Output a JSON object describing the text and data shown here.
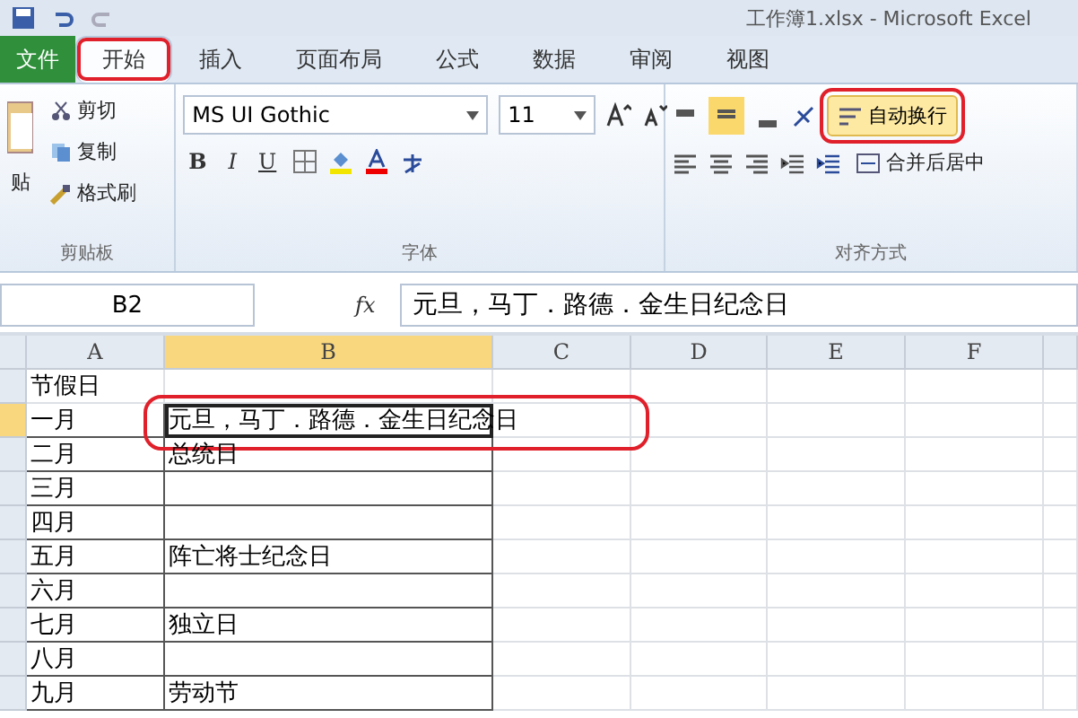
{
  "window": {
    "title": "工作簿1.xlsx - Microsoft Excel"
  },
  "tabs": [
    {
      "label": "文件",
      "kind": "file",
      "selected": false
    },
    {
      "label": "开始",
      "kind": "tab",
      "selected": true
    },
    {
      "label": "插入",
      "kind": "tab",
      "selected": false
    },
    {
      "label": "页面布局",
      "kind": "tab",
      "selected": false
    },
    {
      "label": "公式",
      "kind": "tab",
      "selected": false
    },
    {
      "label": "数据",
      "kind": "tab",
      "selected": false
    },
    {
      "label": "审阅",
      "kind": "tab",
      "selected": false
    },
    {
      "label": "视图",
      "kind": "tab",
      "selected": false
    }
  ],
  "ribbon": {
    "clipboard": {
      "label": "剪贴板",
      "paste": "贴",
      "cut": "剪切",
      "copy": "复制",
      "format_painter": "格式刷"
    },
    "font": {
      "label": "字体",
      "font_name": "MS UI Gothic",
      "font_size": "11",
      "bold": "B",
      "italic": "I",
      "underline": "U"
    },
    "alignment": {
      "label": "对齐方式",
      "wrap_text": {
        "label": "自动换行",
        "selected": true
      },
      "merge": "合并后居中"
    }
  },
  "formula_bar": {
    "name_box": "B2",
    "fx": "fx",
    "formula": "元旦，马丁．路德．金生日纪念日"
  },
  "sheet": {
    "columns": [
      {
        "label": "A",
        "selected": false
      },
      {
        "label": "B",
        "selected": true
      },
      {
        "label": "C",
        "selected": false
      },
      {
        "label": "D",
        "selected": false
      },
      {
        "label": "E",
        "selected": false
      },
      {
        "label": "F",
        "selected": false
      }
    ],
    "rows": [
      {
        "a": "节假日",
        "b": "",
        "active": false
      },
      {
        "a": "一月",
        "b": "元旦，马丁．路德．金生日纪念日",
        "active": true
      },
      {
        "a": "二月",
        "b": "总统日",
        "active": false
      },
      {
        "a": "三月",
        "b": "",
        "active": false
      },
      {
        "a": "四月",
        "b": "",
        "active": false
      },
      {
        "a": "五月",
        "b": "阵亡将士纪念日",
        "active": false
      },
      {
        "a": "六月",
        "b": "",
        "active": false
      },
      {
        "a": "七月",
        "b": "独立日",
        "active": false
      },
      {
        "a": "八月",
        "b": "",
        "active": false
      },
      {
        "a": "九月",
        "b": "劳动节",
        "active": false
      }
    ]
  }
}
